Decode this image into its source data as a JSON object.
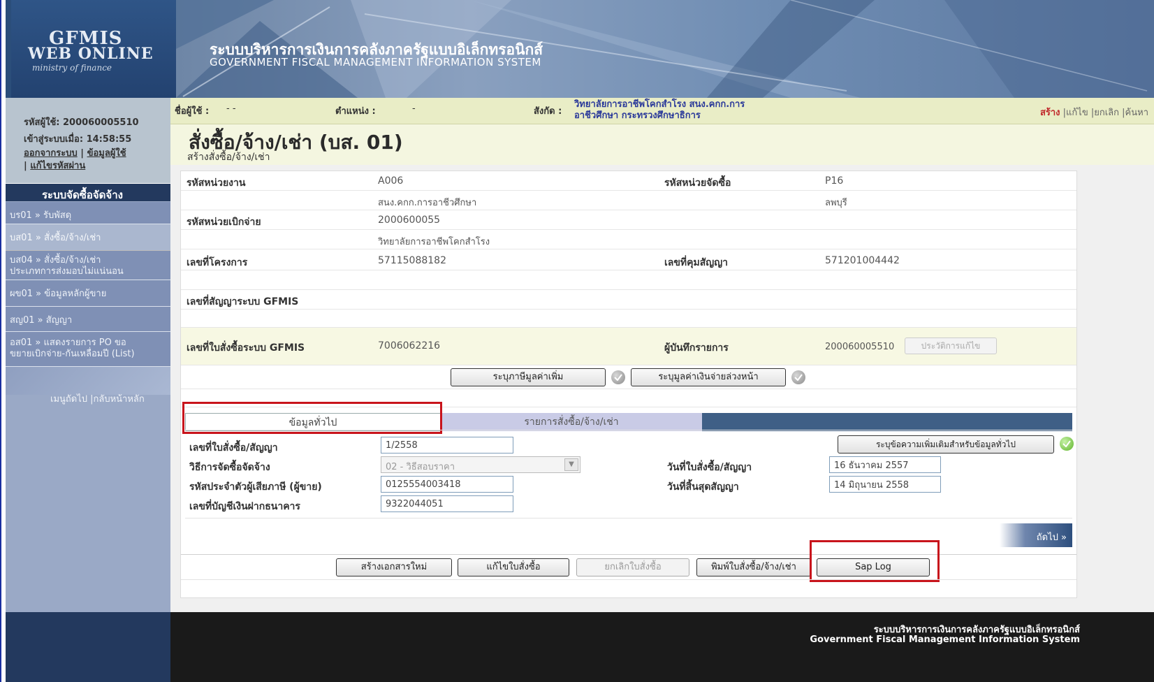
{
  "header": {
    "logo_line1": "GFMIS",
    "logo_line2": "WEB ONLINE",
    "logo_line3": "ministry of finance",
    "title_th": "ระบบบริหารการเงินการคลังภาครัฐแบบอิเล็กทรอนิกส์",
    "title_en": "GOVERNMENT FISCAL MANAGEMENT INFORMATION SYSTEM"
  },
  "user": {
    "user_id": "รหัสผู้ใช้: 200060005510",
    "login_time": "เข้าสู่ระบบเมื่อ: 14:58:55",
    "logout_link": "ออกจากระบบ",
    "userinfo_link": "ข้อมูลผู้ใช้",
    "changepw_link": "แก้ไขรหัสผ่าน",
    "sep": " | "
  },
  "sidebar": {
    "heading": "ระบบจัดซื้อจัดจ้าง",
    "items": [
      {
        "label": "บร01 » รับพัสดุ"
      },
      {
        "label": "บส01 » สั่งซื้อ/จ้าง/เช่า"
      },
      {
        "label": "บส04 » สั่งซื้อ/จ้าง/เช่า"
      },
      {
        "label": "ประเภทการส่งมอบไม่แน่นอน"
      },
      {
        "label": "ผข01 » ข้อมูลหลักผู้ขาย"
      },
      {
        "label": "สญ01 » สัญญา"
      },
      {
        "label": "อส01 » แสดงรายการ PO ขอ"
      },
      {
        "label": "ขยายเบิกจ่าย-กันเหลื่อมปี (List)"
      }
    ],
    "footer_links": "เมนูถัดไป |กลับหน้าหลัก"
  },
  "infobar": {
    "user_label": "ชื่อผู้ใช้ :",
    "user_value": "- -",
    "position_label": "ตำแหน่ง :",
    "position_value": "-",
    "agency_label": "สังกัด :",
    "agency_line1": "วิทยาลัยการอาชีพโคกสำโรง สนง.คกก.การ",
    "agency_line2": "อาชีวศึกษา กระทรวงศึกษาธิการ",
    "action_create": "สร้าง",
    "action_edit": "แก้ไข",
    "action_cancel": "ยกเลิก",
    "action_search": "ค้นหา",
    "bar": " |"
  },
  "page": {
    "title": "สั่งซื้อ/จ้าง/เช่า (บส. 01)",
    "subtitle": "สร้างสั่งซื้อ/จ้าง/เช่า"
  },
  "form": {
    "dept_code_label": "รหัสหน่วยงาน",
    "dept_code": "A006",
    "dept_name": "สนง.คกก.การอาชีวศึกษา",
    "purch_unit_label": "รหัสหน่วยจัดซื้อ",
    "purch_unit": "P16",
    "purch_unit_name": "ลพบุรี",
    "disb_unit_label": "รหัสหน่วยเบิกจ่าย",
    "disb_unit": "2000600055",
    "disb_unit_name": "วิทยาลัยการอาชีพโคกสำโรง",
    "project_label": "เลขที่โครงการ",
    "project_no": "57115088182",
    "control_label": "เลขที่คุมสัญญา",
    "control_no": "571201004442",
    "gf_contract_label": "เลขที่สัญญาระบบ GFMIS",
    "gf_po_label": "เลขที่ใบสั่งซื้อระบบ GFMIS",
    "gf_po_no": "7006062216",
    "recorder_label": "ผู้บันทึกรายการ",
    "recorder": "200060005510",
    "history_button": "ประวัติการแก้ไข",
    "vat_button": "ระบุภาษีมูลค่าเพิ่ม",
    "advance_button": "ระบุมูลค่าเงินจ่ายล่วงหน้า"
  },
  "tabs": [
    {
      "label": "ข้อมูลทั่วไป"
    },
    {
      "label": "รายการสั่งซื้อ/จ้าง/เช่า"
    }
  ],
  "general": {
    "po_no_label": "เลขที่ใบสั่งซื้อ/สัญญา",
    "po_no": "1/2558",
    "method_label": "วิธีการจัดซื้อจัดจ้าง",
    "method": "02 - วิธีสอบราคา",
    "tax_id_label": "รหัสประจำตัวผู้เสียภาษี (ผู้ขาย)",
    "tax_id": "0125554003418",
    "bank_label": "เลขที่บัญชีเงินฝากธนาคาร",
    "bank_no": "9322044051",
    "extra_button": "ระบุข้อความเพิ่มเติมสำหรับข้อมูลทั่วไป",
    "po_date_label": "วันที่ใบสั่งซื้อ/สัญญา",
    "po_date": "16 ธันวาคม 2557",
    "end_date_label": "วันที่สิ้นสุดสัญญา",
    "end_date": "14 มิถุนายน 2558",
    "next_label": "ถัดไป »"
  },
  "bottom_buttons": {
    "new_doc": "สร้างเอกสารใหม่",
    "edit_po": "แก้ไขใบสั่งซื้อ",
    "cancel_po": "ยกเลิกใบสั่งซื้อ",
    "print_po": "พิมพ์ใบสั่งซื้อ/จ้าง/เช่า",
    "sap_log": "Sap Log"
  },
  "footer": {
    "line1": "ระบบบริหารการเงินการคลังภาครัฐแบบอิเล็กทรอนิกส์",
    "line2": "Government Fiscal Management Information System"
  },
  "colors": {
    "header_blue": "#2b4e7a",
    "highlight_red": "#c8141c",
    "create_red": "#c0282b"
  }
}
